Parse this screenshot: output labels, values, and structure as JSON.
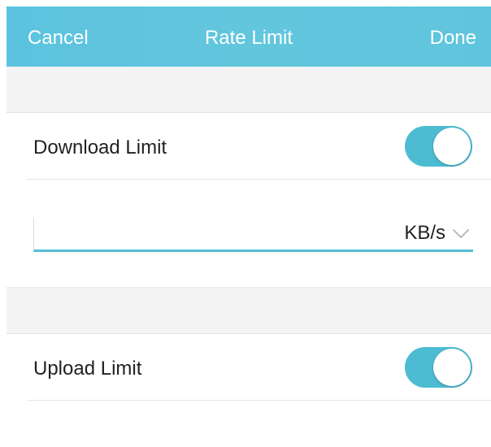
{
  "navbar": {
    "cancel_label": "Cancel",
    "title": "Rate Limit",
    "done_label": "Done"
  },
  "download": {
    "label": "Download Limit",
    "enabled": true,
    "input_value": "",
    "unit": "KB/s",
    "unit_icon": "chevron-down-icon"
  },
  "upload": {
    "label": "Upload Limit",
    "enabled": true
  },
  "colors": {
    "accent": "#4dbcd3",
    "navbar": "#5fc5dd",
    "section_gap": "#f4f4f5"
  }
}
